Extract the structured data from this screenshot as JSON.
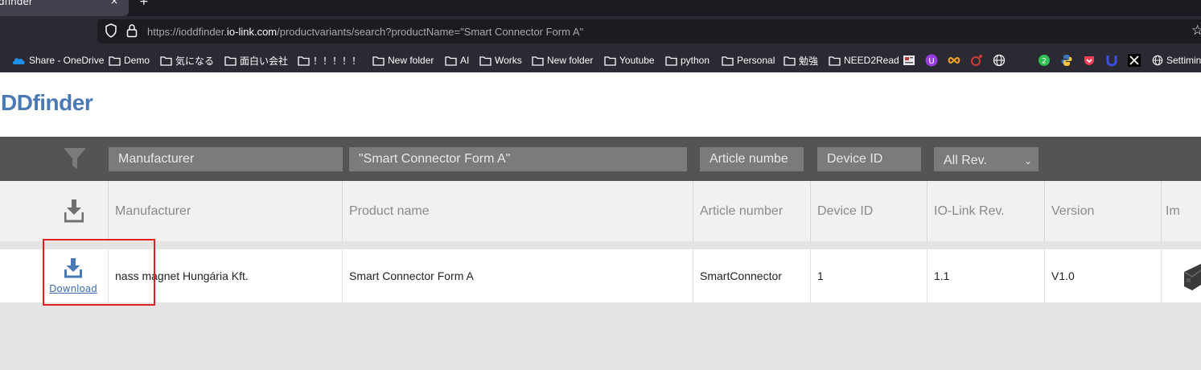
{
  "browser": {
    "tab": {
      "title": "dfinder",
      "close": "×"
    },
    "new_tab": "+",
    "url": {
      "prefix": "https://ioddfinder.",
      "domain": "io-link.com",
      "path": "/productvariants/search?productName=\"Smart Connector Form A\""
    },
    "bookmarks": [
      {
        "label": "Share - OneDrive",
        "icon": "onedrive-icon"
      },
      {
        "label": "Demo",
        "icon": "folder-icon"
      },
      {
        "label": "気になる",
        "icon": "folder-icon"
      },
      {
        "label": "面白い会社",
        "icon": "folder-icon"
      },
      {
        "label": "！！！！！",
        "icon": "folder-icon"
      },
      {
        "label": "New folder",
        "icon": "folder-icon"
      },
      {
        "label": "AI",
        "icon": "folder-icon"
      },
      {
        "label": "Works",
        "icon": "folder-icon"
      },
      {
        "label": "New folder",
        "icon": "folder-icon"
      },
      {
        "label": "Youtube",
        "icon": "folder-icon"
      },
      {
        "label": "python",
        "icon": "folder-icon"
      },
      {
        "label": "Personal",
        "icon": "folder-icon"
      },
      {
        "label": "勉強",
        "icon": "folder-icon"
      },
      {
        "label": "NEED2Read",
        "icon": "folder-icon"
      },
      {
        "label": "Settimin",
        "icon": "globe-icon"
      }
    ]
  },
  "site": {
    "logo": "DDfinder"
  },
  "filters": {
    "manufacturer": "Manufacturer",
    "product_name": "\"Smart Connector Form A\"",
    "article_number": "Article numbe",
    "device_id": "Device ID",
    "revision": "All Rev."
  },
  "table": {
    "headers": [
      "Manufacturer",
      "Product name",
      "Article number",
      "Device ID",
      "IO-Link Rev.",
      "Version",
      "Im"
    ],
    "rows": [
      {
        "download_label": "Download",
        "manufacturer": "nass magnet Hungária Kft.",
        "product_name": "Smart Connector Form A",
        "article_number": "SmartConnector",
        "device_id": "1",
        "io_link_rev": "1.1",
        "version": "V1.0"
      }
    ]
  },
  "colors": {
    "accent": "#4a7ab5",
    "filterbar": "#545454",
    "highlight": "#e02020"
  }
}
